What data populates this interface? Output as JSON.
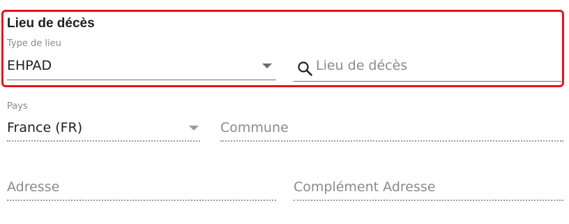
{
  "section": {
    "title": "Lieu de décès"
  },
  "type_de_lieu": {
    "label": "Type de lieu",
    "value": "EHPAD",
    "icon": "chevron-down-icon"
  },
  "lieu_de_deces": {
    "placeholder": "Lieu de décès",
    "icon": "search-icon"
  },
  "pays": {
    "label": "Pays",
    "value": "France (FR)",
    "icon": "chevron-down-icon"
  },
  "commune": {
    "placeholder": "Commune"
  },
  "adresse": {
    "placeholder": "Adresse"
  },
  "complement_adresse": {
    "placeholder": "Complément Adresse"
  },
  "colors": {
    "highlight_border": "#e8121c",
    "label_gray": "#8a8a8a",
    "text_dark": "#1f1f1f"
  }
}
